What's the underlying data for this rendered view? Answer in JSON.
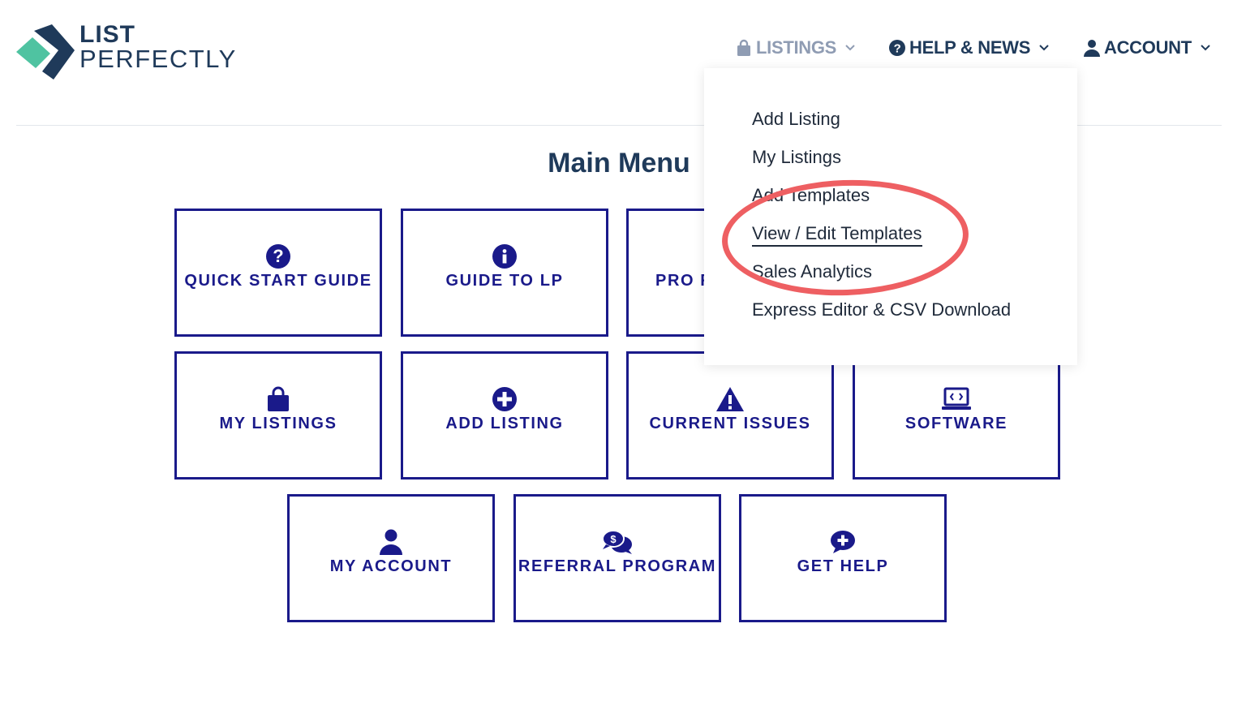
{
  "brand": {
    "line1": "LIST",
    "line2": "PERFECTLY",
    "colors": {
      "navy": "#1f3a5a",
      "teal": "#4fc3a1"
    }
  },
  "nav": {
    "listings": {
      "label": "LISTINGS",
      "icon": "bag-icon"
    },
    "help": {
      "label": "HELP & NEWS",
      "icon": "question-circle-icon"
    },
    "account": {
      "label": "ACCOUNT",
      "icon": "user-icon"
    }
  },
  "page": {
    "title": "Main Menu"
  },
  "tiles": [
    {
      "label": "QUICK START GUIDE",
      "icon": "question-circle-icon"
    },
    {
      "label": "GUIDE TO LP",
      "icon": "info-circle-icon"
    },
    {
      "label": "PRO F",
      "icon": ""
    },
    {
      "label": "MY LISTINGS",
      "icon": "bag-icon"
    },
    {
      "label": "ADD LISTING",
      "icon": "plus-circle-icon"
    },
    {
      "label": "CURRENT ISSUES",
      "icon": "warning-icon"
    },
    {
      "label": "SOFTWARE",
      "icon": "laptop-code-icon"
    },
    {
      "label": "MY ACCOUNT",
      "icon": "user-icon"
    },
    {
      "label": "REFERRAL PROGRAM",
      "icon": "chat-dollar-icon"
    },
    {
      "label": "GET HELP",
      "icon": "chat-plus-icon"
    }
  ],
  "dropdown": {
    "items": [
      {
        "label": "Add Listing"
      },
      {
        "label": "My Listings"
      },
      {
        "label": "Add Templates"
      },
      {
        "label": "View / Edit Templates"
      },
      {
        "label": "Sales Analytics"
      },
      {
        "label": "Express Editor & CSV Download"
      }
    ],
    "highlight_color": "#ee5f62"
  }
}
